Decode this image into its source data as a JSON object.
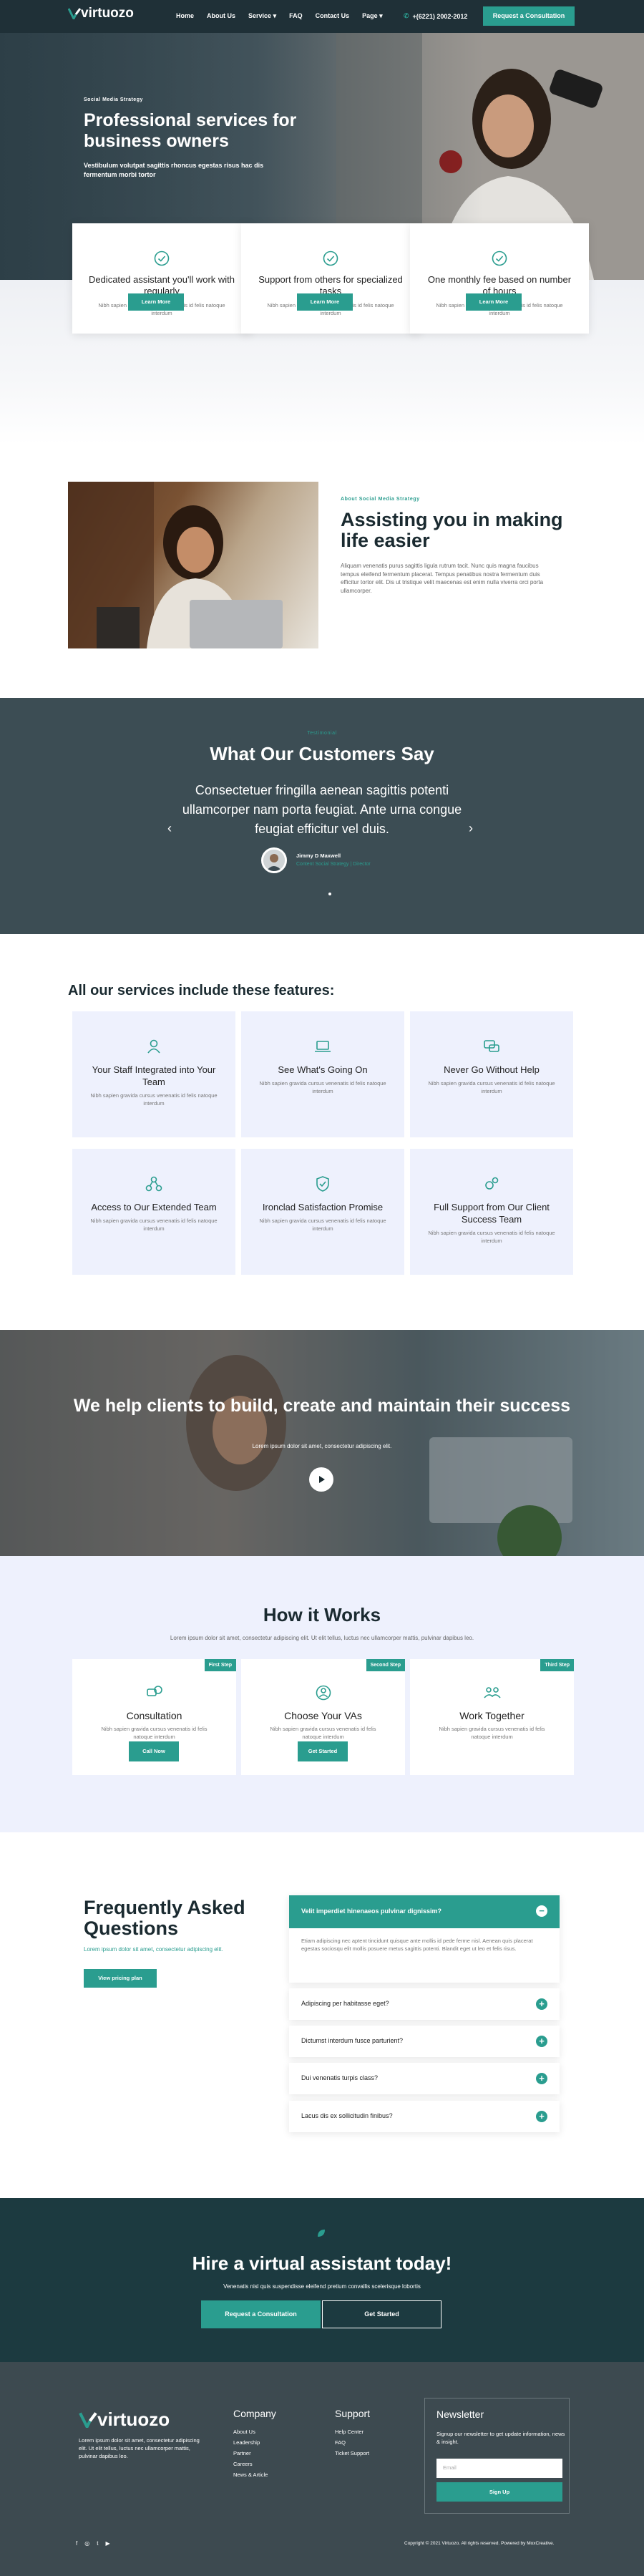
{
  "header": {
    "logo_text": "virtuozo",
    "nav": [
      "Home",
      "About Us",
      "Service",
      "FAQ",
      "Contact Us",
      "Page"
    ],
    "phone": "+(6221) 2002-2012",
    "cta": "Request a Consultation"
  },
  "hero": {
    "eyebrow": "Social Media Strategy",
    "title": "Professional services for business owners",
    "subtitle": "Vestibulum volutpat sagittis rhoncus egestas risus hac dis fermentum morbi tortor"
  },
  "feature_cards": [
    {
      "title": "Dedicated assistant you'll work with regularly",
      "text": "Nibh sapien gravida cursus venenatis id felis natoque interdum",
      "button": "Learn More"
    },
    {
      "title": "Support from others for specialized tasks",
      "text": "Nibh sapien gravida cursus venenatis id felis natoque interdum",
      "button": "Learn More"
    },
    {
      "title": "One monthly fee based on number of hours",
      "text": "Nibh sapien gravida cursus venenatis id felis natoque interdum",
      "button": "Learn More"
    }
  ],
  "assist": {
    "eyebrow": "About Social Media Strategy",
    "title": "Assisting you in making life easier",
    "text": "Aliquam venenatis purus sagittis ligula rutrum tacit. Nunc quis magna faucibus tempus eleifend fermentum placerat. Tempus penatibus nostra fermentum duis efficitur tortor elit. Dis ut tristique velit maecenas est enim nulla viverra orci porta ullamcorper."
  },
  "testimonials": {
    "eyebrow": "Testimonial",
    "title": "What Our Customers Say",
    "quote": "Consectetuer fringilla aenean sagittis potenti ullamcorper nam porta feugiat. Ante urna congue feugiat efficitur vel duis.",
    "name": "Jimmy D Maxwell",
    "role": "Content Social Strategy | Director"
  },
  "services": {
    "title": "All our services include these features:",
    "items": [
      {
        "title": "Your Staff Integrated into Your Team",
        "text": "Nibh sapien gravida cursus venenatis id felis natoque interdum"
      },
      {
        "title": "See What's Going On",
        "text": "Nibh sapien gravida cursus venenatis id felis natoque interdum"
      },
      {
        "title": "Never Go Without Help",
        "text": "Nibh sapien gravida cursus venenatis id felis natoque interdum"
      },
      {
        "title": "Access to Our Extended Team",
        "text": "Nibh sapien gravida cursus venenatis id felis natoque interdum"
      },
      {
        "title": "Ironclad Satisfaction Promise",
        "text": "Nibh sapien gravida cursus venenatis id felis natoque interdum"
      },
      {
        "title": "Full Support from Our Client Success Team",
        "text": "Nibh sapien gravida cursus venenatis id felis natoque interdum"
      }
    ]
  },
  "clients": {
    "title": "We help clients to build, create and maintain their success",
    "subtitle": "Lorem ipsum dolor sit amet, consectetur adipiscing elit."
  },
  "how": {
    "title": "How it Works",
    "subtitle": "Lorem ipsum dolor sit amet, consectetur adipiscing elit. Ut elit tellus, luctus nec ullamcorper mattis, pulvinar dapibus leo.",
    "steps": [
      {
        "badge": "First Step",
        "title": "Consultation",
        "text": "Nibh sapien gravida cursus venenatis id felis natoque interdum",
        "button": "Call Now"
      },
      {
        "badge": "Second Step",
        "title": "Choose Your VAs",
        "text": "Nibh sapien gravida cursus venenatis id felis natoque interdum",
        "button": "Get Started"
      },
      {
        "badge": "Third Step",
        "title": "Work Together",
        "text": "Nibh sapien gravida cursus venenatis id felis natoque interdum"
      }
    ]
  },
  "faq": {
    "title": "Frequently Asked Questions",
    "subtitle": "Lorem ipsum dolor sit amet, consectetur adipiscing elit.",
    "button": "View pricing plan",
    "open_q": "Velit imperdiet hinenaeos pulvinar dignissim?",
    "open_a": "Etiam adipiscing nec aptent tincidunt quisque ante mollis id pede ferme nisl. Aenean quis placerat egestas sociosqu elit mollis posuere metus sagittis potenti. Blandit eget ut leo et felis risus.",
    "items": [
      "Adipiscing per habitasse eget?",
      "Dictumst interdum fusce parturient?",
      "Dui venenatis turpis class?",
      "Lacus dis ex sollicitudin finibus?"
    ]
  },
  "cta": {
    "title": "Hire a virtual assistant today!",
    "subtitle": "Venenatis nisl quis suspendisse eleifend pretium convallis scelerisque lobortis",
    "button1": "Request a Consultation",
    "button2": "Get Started"
  },
  "footer": {
    "logo_text": "virtuozo",
    "desc": "Lorem ipsum dolor sit amet, consectetur adipiscing elit. Ut elit tellus, luctus nec ullamcorper mattis, pulvinar dapibus leo.",
    "company": {
      "title": "Company",
      "links": [
        "About Us",
        "Leadership",
        "Partner",
        "Careers",
        "News & Article"
      ]
    },
    "support": {
      "title": "Support",
      "links": [
        "Help Center",
        "FAQ",
        "Ticket Support"
      ]
    },
    "newsletter": {
      "title": "Newsletter",
      "text": "Signup our newsletter to get update information, news & insight.",
      "placeholder": "Email",
      "button": "Sign Up"
    },
    "copyright": "Copyright © 2021 Virtuozo. All rights reserved. Powered by MoxCreative."
  },
  "colors": {
    "accent": "#2a9d8f",
    "dark": "#1f3037",
    "testimonial_bg": "#3c4d54",
    "cta_bg": "#1c3a40",
    "footer_bg": "#3d4a50",
    "card_bg": "#eef1fd"
  }
}
